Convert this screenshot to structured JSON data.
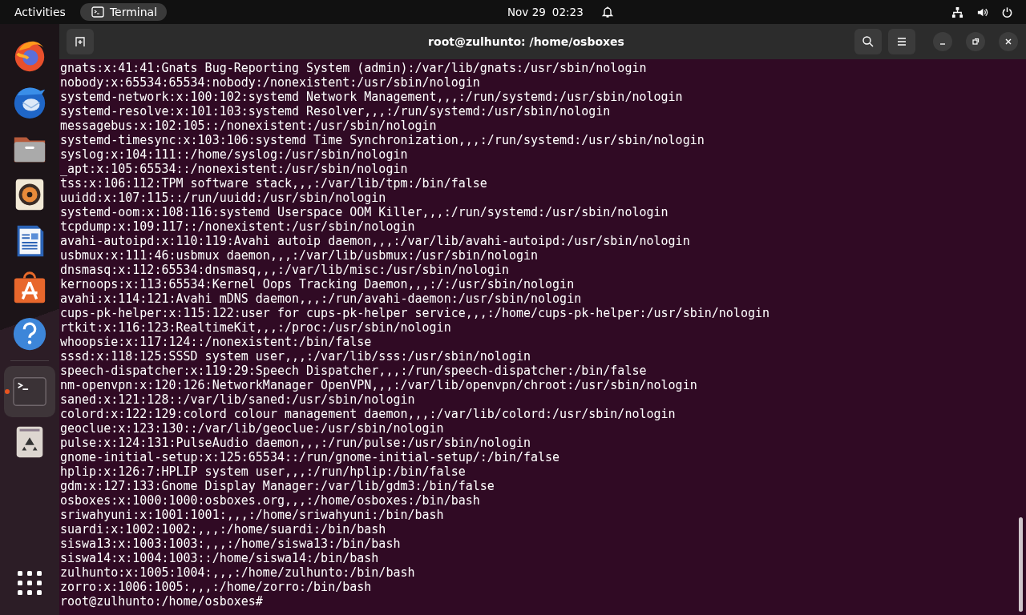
{
  "top_bar": {
    "activities": "Activities",
    "app_menu": "Terminal",
    "date": "Nov 29",
    "time": "02:23"
  },
  "dock": {
    "apps": [
      {
        "kind": "browser",
        "running": false
      },
      {
        "kind": "mail",
        "running": false
      },
      {
        "kind": "files",
        "running": false
      },
      {
        "kind": "music",
        "running": false
      },
      {
        "kind": "writer",
        "running": false
      },
      {
        "kind": "store",
        "running": false
      },
      {
        "kind": "help",
        "running": false
      },
      {
        "kind": "terminal",
        "running": true
      },
      {
        "kind": "trash",
        "running": false
      }
    ]
  },
  "window": {
    "title": "root@zulhunto: /home/osboxes"
  },
  "terminal": {
    "lines": [
      "gnats:x:41:41:Gnats Bug-Reporting System (admin):/var/lib/gnats:/usr/sbin/nologin",
      "nobody:x:65534:65534:nobody:/nonexistent:/usr/sbin/nologin",
      "systemd-network:x:100:102:systemd Network Management,,,:/run/systemd:/usr/sbin/nologin",
      "systemd-resolve:x:101:103:systemd Resolver,,,:/run/systemd:/usr/sbin/nologin",
      "messagebus:x:102:105::/nonexistent:/usr/sbin/nologin",
      "systemd-timesync:x:103:106:systemd Time Synchronization,,,:/run/systemd:/usr/sbin/nologin",
      "syslog:x:104:111::/home/syslog:/usr/sbin/nologin",
      "_apt:x:105:65534::/nonexistent:/usr/sbin/nologin",
      "tss:x:106:112:TPM software stack,,,:/var/lib/tpm:/bin/false",
      "uuidd:x:107:115::/run/uuidd:/usr/sbin/nologin",
      "systemd-oom:x:108:116:systemd Userspace OOM Killer,,,:/run/systemd:/usr/sbin/nologin",
      "tcpdump:x:109:117::/nonexistent:/usr/sbin/nologin",
      "avahi-autoipd:x:110:119:Avahi autoip daemon,,,:/var/lib/avahi-autoipd:/usr/sbin/nologin",
      "usbmux:x:111:46:usbmux daemon,,,:/var/lib/usbmux:/usr/sbin/nologin",
      "dnsmasq:x:112:65534:dnsmasq,,,:/var/lib/misc:/usr/sbin/nologin",
      "kernoops:x:113:65534:Kernel Oops Tracking Daemon,,,:/:/usr/sbin/nologin",
      "avahi:x:114:121:Avahi mDNS daemon,,,:/run/avahi-daemon:/usr/sbin/nologin",
      "cups-pk-helper:x:115:122:user for cups-pk-helper service,,,:/home/cups-pk-helper:/usr/sbin/nologin",
      "rtkit:x:116:123:RealtimeKit,,,:/proc:/usr/sbin/nologin",
      "whoopsie:x:117:124::/nonexistent:/bin/false",
      "sssd:x:118:125:SSSD system user,,,:/var/lib/sss:/usr/sbin/nologin",
      "speech-dispatcher:x:119:29:Speech Dispatcher,,,:/run/speech-dispatcher:/bin/false",
      "nm-openvpn:x:120:126:NetworkManager OpenVPN,,,:/var/lib/openvpn/chroot:/usr/sbin/nologin",
      "saned:x:121:128::/var/lib/saned:/usr/sbin/nologin",
      "colord:x:122:129:colord colour management daemon,,,:/var/lib/colord:/usr/sbin/nologin",
      "geoclue:x:123:130::/var/lib/geoclue:/usr/sbin/nologin",
      "pulse:x:124:131:PulseAudio daemon,,,:/run/pulse:/usr/sbin/nologin",
      "gnome-initial-setup:x:125:65534::/run/gnome-initial-setup/:/bin/false",
      "hplip:x:126:7:HPLIP system user,,,:/run/hplip:/bin/false",
      "gdm:x:127:133:Gnome Display Manager:/var/lib/gdm3:/bin/false",
      "osboxes:x:1000:1000:osboxes.org,,,:/home/osboxes:/bin/bash",
      "sriwahyuni:x:1001:1001:,,,:/home/sriwahyuni:/bin/bash",
      "suardi:x:1002:1002:,,,:/home/suardi:/bin/bash",
      "siswa13:x:1003:1003:,,,:/home/siswa13:/bin/bash",
      "siswa14:x:1004:1003::/home/siswa14:/bin/bash",
      "zulhunto:x:1005:1004:,,,:/home/zulhunto:/bin/bash",
      "zorro:x:1006:1005:,,,:/home/zorro:/bin/bash"
    ],
    "prompt": "root@zulhunto:/home/osboxes#"
  }
}
